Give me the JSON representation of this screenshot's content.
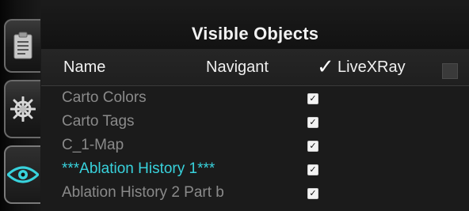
{
  "rail": {
    "buttons": [
      {
        "icon": "clipboard-icon"
      },
      {
        "icon": "ship-wheel-icon"
      },
      {
        "icon": "eye-icon",
        "active": true
      }
    ],
    "accent": "#38d2dc"
  },
  "panel": {
    "title": "Visible Objects",
    "columns": {
      "name": "Name",
      "navigant": "Navigant",
      "check": "✓",
      "livexray": "LiveXRay"
    },
    "rows": [
      {
        "label": "Carto Colors",
        "checked": true,
        "active": false
      },
      {
        "label": "Carto Tags",
        "checked": true,
        "active": false
      },
      {
        "label": "C_1-Map",
        "checked": true,
        "active": false
      },
      {
        "label": "***Ablation History 1***",
        "checked": true,
        "active": true
      },
      {
        "label": "Ablation History 2 Part b",
        "checked": true,
        "active": false
      }
    ],
    "check_glyph": "✓"
  }
}
